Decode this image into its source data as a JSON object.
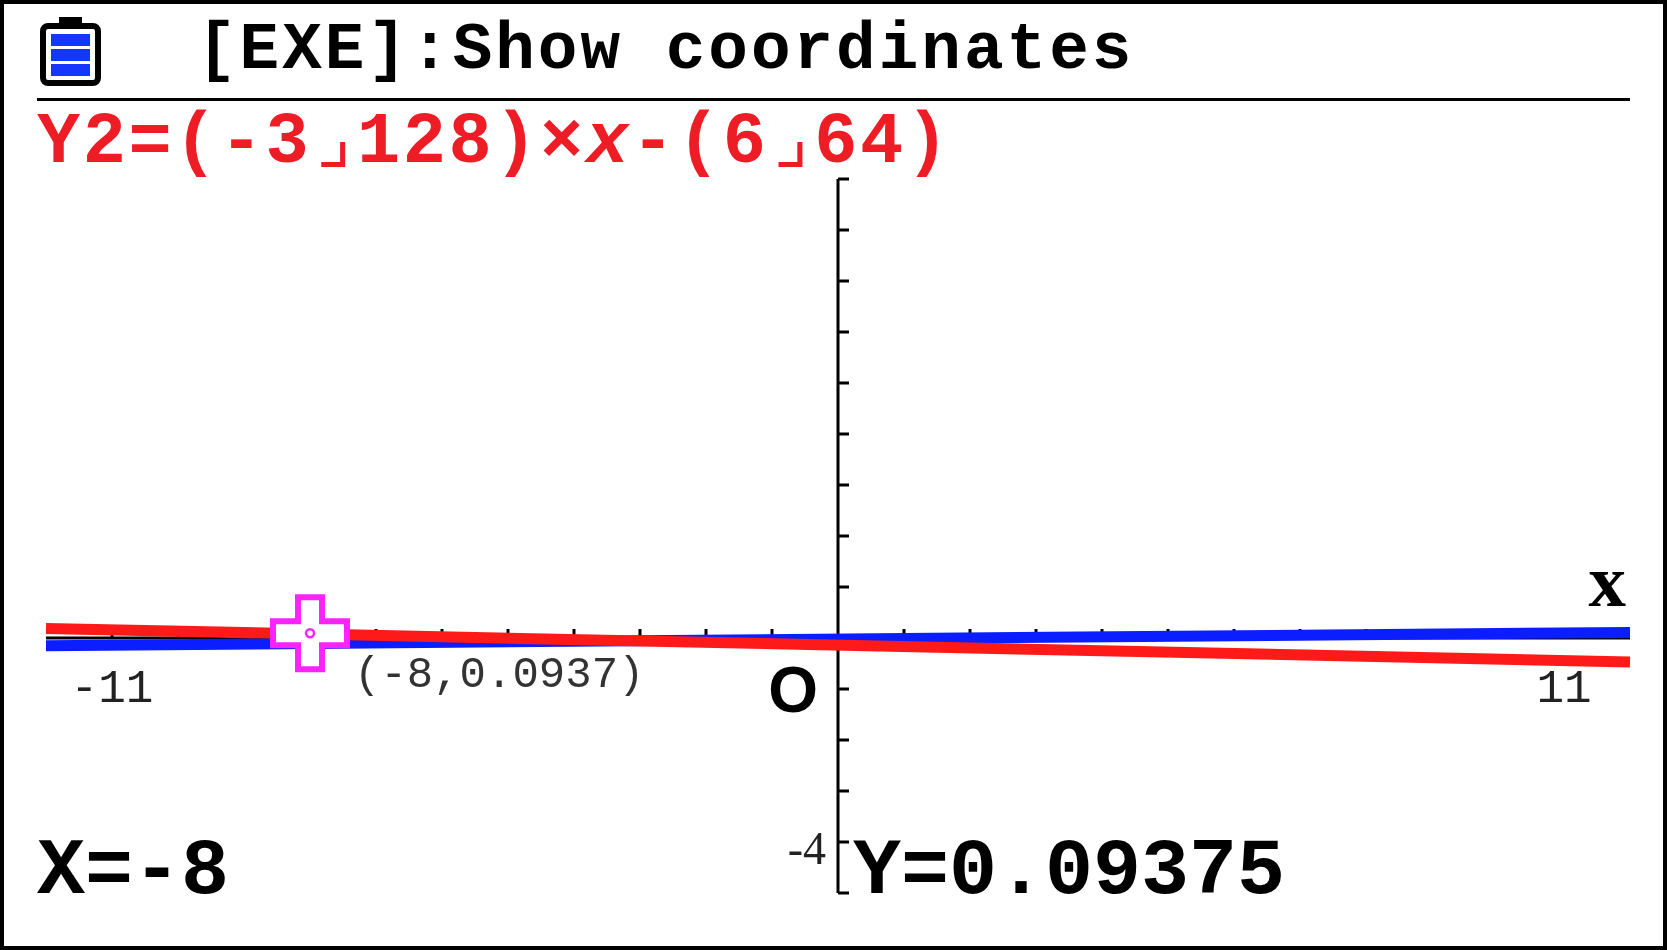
{
  "header": {
    "title": "[EXE]:Show coordinates"
  },
  "function": {
    "text": "Y2=(-3⌟128)×*x*-(6⌟64)"
  },
  "graph": {
    "curves": [
      {
        "color": "#0a1eff"
      },
      {
        "color": "#ff1a1a"
      }
    ],
    "axis_label": "x",
    "origin_label": "O",
    "x_tick_labels": [
      "-11",
      "11"
    ],
    "y_tick_labels": [
      "-4"
    ],
    "cursor": {
      "label": "(-8,0.0937)"
    }
  },
  "readout": {
    "x": "X=-8",
    "y": "Y=0.09375"
  }
}
